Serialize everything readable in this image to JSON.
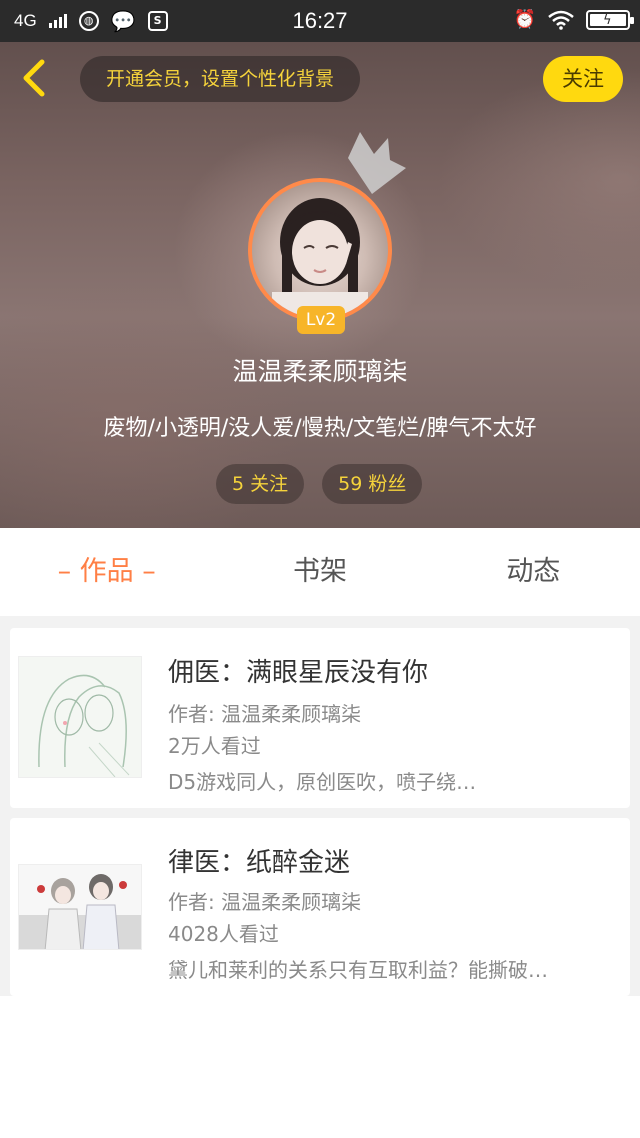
{
  "status_bar": {
    "network": "4G",
    "sim_icon_label": "S",
    "time": "16:27"
  },
  "header": {
    "vip_prompt": "开通会员，设置个性化背景",
    "follow_label": "关注",
    "level_badge": "Lv2",
    "username": "温温柔柔顾璃柒",
    "bio": "废物/小透明/没人爱/慢热/文笔烂/脾气不太好",
    "stats": [
      {
        "label": "5 关注"
      },
      {
        "label": "59 粉丝"
      }
    ]
  },
  "tabs": [
    {
      "label": "– 作品 –",
      "active": true
    },
    {
      "label": "书架",
      "active": false
    },
    {
      "label": "动态",
      "active": false
    }
  ],
  "works": [
    {
      "title": "佣医：满眼星辰没有你",
      "author": "作者: 温温柔柔顾璃柒",
      "views": "2万人看过",
      "summary": "D5游戏同人，原创医吹，喷子绕…"
    },
    {
      "title": "律医：纸醉金迷",
      "author": "作者: 温温柔柔顾璃柒",
      "views": "4028人看过",
      "summary": "黛儿和莱利的关系只有互取利益？能撕破…"
    }
  ],
  "colors": {
    "accent_orange": "#ff7f45",
    "follow_yellow": "#ffd90f",
    "gold_text": "#f5d33b"
  }
}
